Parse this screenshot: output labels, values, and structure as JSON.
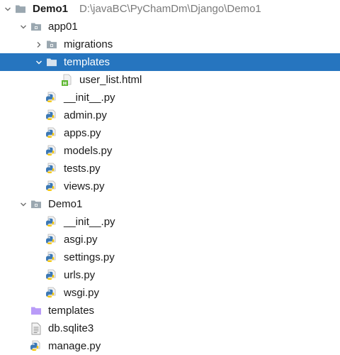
{
  "tree": [
    {
      "id": "demo1-root",
      "label": "Demo1",
      "path": "D:\\javaBC\\PyChamDm\\Django\\Demo1",
      "depth": 0,
      "icon": "folder-icon",
      "expander": "expanded",
      "bold": true
    },
    {
      "id": "app01",
      "label": "app01",
      "depth": 1,
      "icon": "package-folder-icon",
      "expander": "expanded"
    },
    {
      "id": "migrations",
      "label": "migrations",
      "depth": 2,
      "icon": "package-folder-icon",
      "expander": "collapsed"
    },
    {
      "id": "app01-templates",
      "label": "templates",
      "depth": 2,
      "icon": "folder-icon",
      "expander": "expanded",
      "selected": true
    },
    {
      "id": "user-list-html",
      "label": "user_list.html",
      "depth": 3,
      "icon": "html-file-icon"
    },
    {
      "id": "app01-init",
      "label": "__init__.py",
      "depth": 2,
      "icon": "python-file-icon"
    },
    {
      "id": "admin-py",
      "label": "admin.py",
      "depth": 2,
      "icon": "python-file-icon"
    },
    {
      "id": "apps-py",
      "label": "apps.py",
      "depth": 2,
      "icon": "python-file-icon"
    },
    {
      "id": "models-py",
      "label": "models.py",
      "depth": 2,
      "icon": "python-file-icon"
    },
    {
      "id": "tests-py",
      "label": "tests.py",
      "depth": 2,
      "icon": "python-file-icon"
    },
    {
      "id": "views-py",
      "label": "views.py",
      "depth": 2,
      "icon": "python-file-icon"
    },
    {
      "id": "demo1-pkg",
      "label": "Demo1",
      "depth": 1,
      "icon": "package-folder-icon",
      "expander": "expanded"
    },
    {
      "id": "demo1-init",
      "label": "__init__.py",
      "depth": 2,
      "icon": "python-file-icon"
    },
    {
      "id": "asgi-py",
      "label": "asgi.py",
      "depth": 2,
      "icon": "python-file-icon"
    },
    {
      "id": "settings-py",
      "label": "settings.py",
      "depth": 2,
      "icon": "python-file-icon"
    },
    {
      "id": "urls-py",
      "label": "urls.py",
      "depth": 2,
      "icon": "python-file-icon"
    },
    {
      "id": "wsgi-py",
      "label": "wsgi.py",
      "depth": 2,
      "icon": "python-file-icon"
    },
    {
      "id": "root-templates",
      "label": "templates",
      "depth": 1,
      "icon": "templates-folder-icon"
    },
    {
      "id": "db-sqlite3",
      "label": "db.sqlite3",
      "depth": 1,
      "icon": "text-file-icon"
    },
    {
      "id": "manage-py",
      "label": "manage.py",
      "depth": 1,
      "icon": "python-file-icon"
    }
  ],
  "colors": {
    "selection": "#2675bf",
    "folder": "#9aa7b0",
    "templates_folder": "#b99bf8",
    "python_blue": "#3b78b5",
    "python_yellow": "#f6c600",
    "html_green": "#5fb832",
    "path_text": "#7a7a7a"
  }
}
